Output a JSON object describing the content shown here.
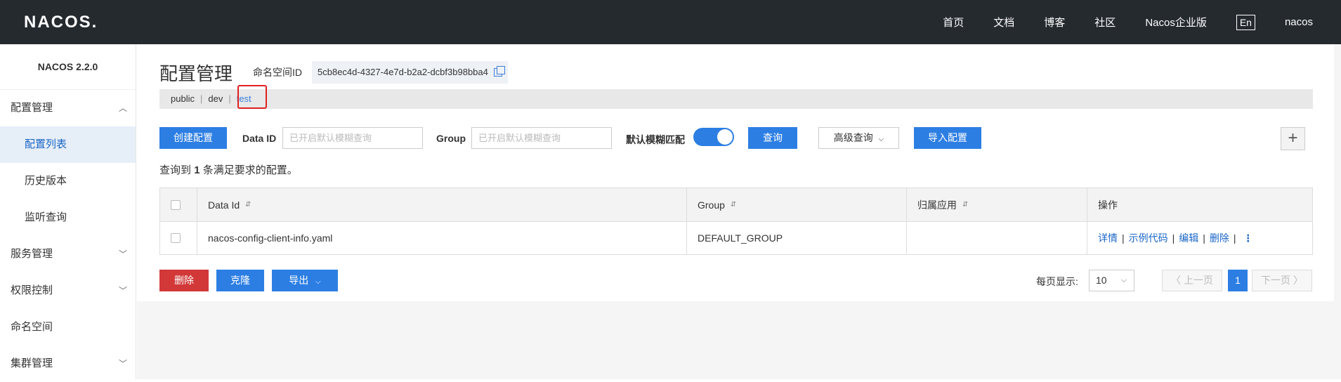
{
  "header": {
    "logo": "NACOS.",
    "nav": [
      "首页",
      "文档",
      "博客",
      "社区",
      "Nacos企业版"
    ],
    "lang": "En",
    "user": "nacos"
  },
  "sidebar": {
    "version": "NACOS 2.2.0",
    "groups": [
      {
        "label": "配置管理",
        "expanded": true
      },
      {
        "label": "服务管理"
      },
      {
        "label": "权限控制"
      },
      {
        "label": "命名空间"
      },
      {
        "label": "集群管理"
      }
    ],
    "config_items": [
      "配置列表",
      "历史版本",
      "监听查询"
    ]
  },
  "main": {
    "title": "配置管理",
    "ns_label": "命名空间ID",
    "ns_id": "5cb8ec4d-4327-4e7d-b2a2-dcbf3b98bba4",
    "namespaces": [
      "public",
      "dev",
      "test"
    ],
    "separator": "|",
    "current_namespace": "test",
    "highlight_color": "#e02020"
  },
  "query": {
    "create_btn": "创建配置",
    "data_id_label": "Data ID",
    "data_id_placeholder": "已开启默认模糊查询",
    "group_label": "Group",
    "group_placeholder": "已开启默认模糊查询",
    "fuzzy_label": "默认模糊匹配",
    "fuzzy_on": true,
    "search_btn": "查询",
    "advanced_btn": "高级查询",
    "import_btn": "导入配置",
    "add_icon": "+"
  },
  "result": {
    "prefix": "查询到",
    "count": "1",
    "suffix": "条满足要求的配置。"
  },
  "table": {
    "headers": [
      "Data Id",
      "Group",
      "归属应用",
      "操作"
    ],
    "rows": [
      {
        "data_id": "nacos-config-client-info.yaml",
        "group": "DEFAULT_GROUP",
        "app": "",
        "ops": [
          "详情",
          "示例代码",
          "编辑",
          "删除"
        ]
      }
    ]
  },
  "footer": {
    "delete_btn": "删除",
    "clone_btn": "克隆",
    "export_btn": "导出",
    "page_size_label": "每页显示:",
    "page_size": "10",
    "prev": "上一页",
    "current_page": "1",
    "next": "下一页"
  },
  "colors": {
    "primary": "#2c7ee3",
    "danger": "#d23838",
    "topbar": "#252a2f"
  }
}
